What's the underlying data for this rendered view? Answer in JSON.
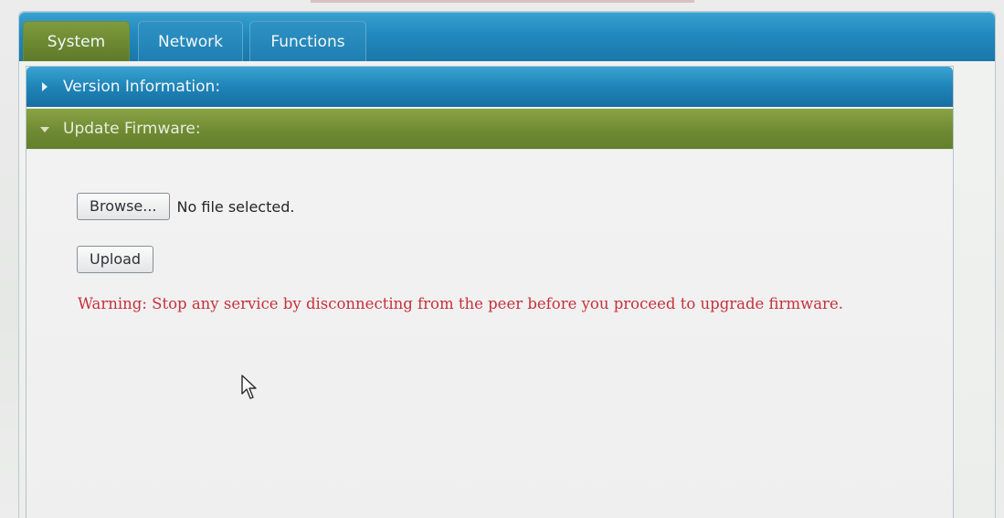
{
  "tabs": [
    {
      "label": "System",
      "active": true
    },
    {
      "label": "Network",
      "active": false
    },
    {
      "label": "Functions",
      "active": false
    }
  ],
  "accordion": {
    "version": {
      "label": "Version Information:",
      "expanded": false
    },
    "firmware": {
      "label": "Update Firmware:",
      "expanded": true
    }
  },
  "firmware": {
    "browse_label": "Browse...",
    "file_status": "No file selected.",
    "upload_label": "Upload",
    "warning": "Warning: Stop any service by disconnecting from the peer before you proceed to upgrade firmware."
  },
  "icons": {
    "collapsed": "triangle-right-icon",
    "expanded": "triangle-down-icon",
    "pointer": "mouse-cursor-icon"
  },
  "colors": {
    "tab_blue": "#2189bd",
    "active_green": "#6a8730",
    "warning_red": "#c6323a"
  }
}
